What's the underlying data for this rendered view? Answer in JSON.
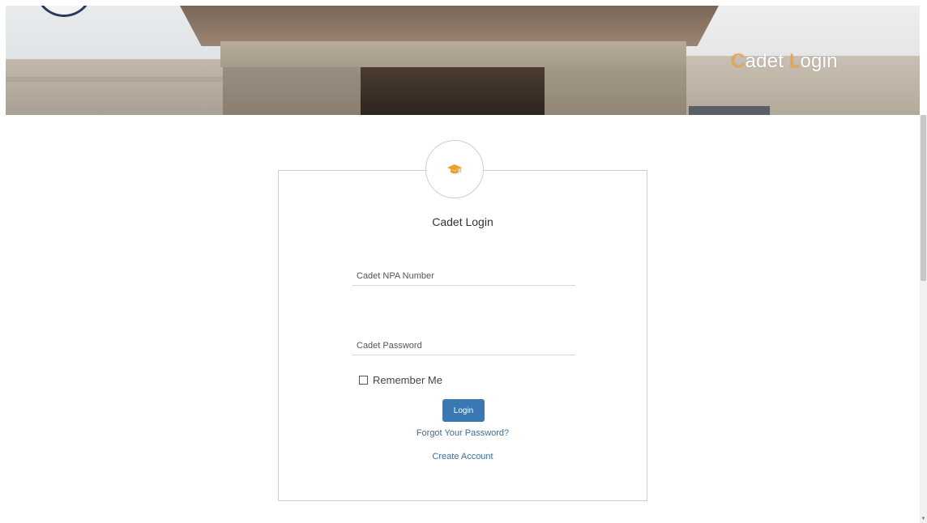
{
  "banner": {
    "title_accent_1": "C",
    "title_rest_1": "adet ",
    "title_accent_2": "L",
    "title_rest_2": "ogin"
  },
  "card": {
    "icon": "graduation-cap-icon",
    "title": "Cadet Login",
    "npa_label": "Cadet NPA Number",
    "npa_value": "",
    "password_label": "Cadet Password",
    "password_value": "",
    "remember_label": "Remember Me",
    "remember_checked": false,
    "login_button": "Login",
    "forgot_link": "Forgot Your Password?",
    "create_link": "Create Account"
  },
  "colors": {
    "accent": "#f0a43a",
    "button": "#3a78b4",
    "link": "#3c6e9c"
  }
}
